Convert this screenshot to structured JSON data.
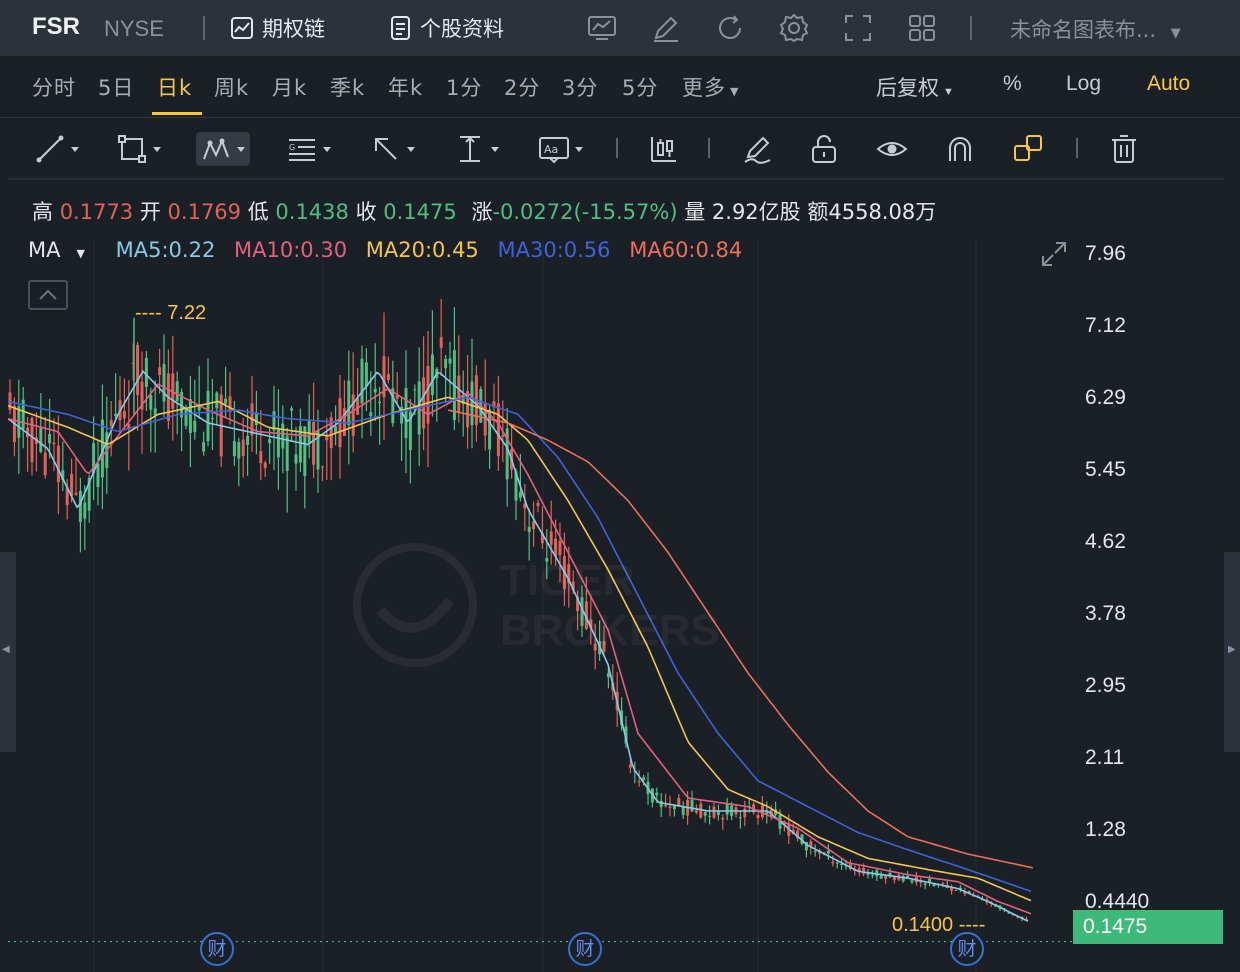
{
  "header": {
    "ticker": "FSR",
    "exchange": "NYSE",
    "options_chain_label": "期权链",
    "stock_profile_label": "个股资料",
    "chart_name": "未命名图表布..."
  },
  "periods": {
    "items": [
      "分时",
      "5日",
      "日k",
      "周k",
      "月k",
      "季k",
      "年k",
      "1分",
      "2分",
      "3分",
      "5分",
      "更多"
    ],
    "active": "日k"
  },
  "options": {
    "adjust_label": "后复权",
    "percent_label": "%",
    "log_label": "Log",
    "auto_label": "Auto"
  },
  "quote": {
    "high_label": "高",
    "high": "0.1773",
    "open_label": "开",
    "open": "0.1769",
    "low_label": "低",
    "low": "0.1438",
    "close_label": "收",
    "close": "0.1475",
    "change_label": "涨",
    "change": "-0.0272(-15.57%)",
    "volume_label": "量",
    "volume": "2.92亿股",
    "amount_label": "额",
    "amount": "4558.08万"
  },
  "ma": {
    "label": "MA",
    "ma5": "MA5:0.22",
    "ma10": "MA10:0.30",
    "ma20": "MA20:0.45",
    "ma30": "MA30:0.56",
    "ma60": "MA60:0.84"
  },
  "colors": {
    "up": "#e0635a",
    "down": "#4fbf83",
    "ma5": "#86cbe8",
    "ma10": "#e2617e",
    "ma20": "#f1c550",
    "ma30": "#3f63d8",
    "ma60": "#ea6f5c",
    "accent": "#f5c842"
  },
  "annotations": {
    "high_marker": "---- 7.22",
    "low_marker": "0.1400 ----",
    "earnings_badge": "财",
    "last_price": "0.1475"
  },
  "watermark": {
    "line1": "TIGER",
    "line2": "BROKERS"
  },
  "chart_data": {
    "type": "candlestick",
    "y_ticks": [
      "7.96",
      "7.12",
      "6.29",
      "5.45",
      "4.62",
      "3.78",
      "2.95",
      "2.11",
      "1.28",
      "0.4440"
    ],
    "ylim": [
      0.1,
      7.96
    ],
    "period_high": 7.22,
    "period_low": 0.14,
    "last_close": 0.1475,
    "ma_series": [
      {
        "name": "MA5",
        "anchors": [
          [
            0,
            6.05
          ],
          [
            40,
            5.7
          ],
          [
            70,
            5.0
          ],
          [
            110,
            6.1
          ],
          [
            135,
            6.6
          ],
          [
            160,
            6.3
          ],
          [
            200,
            6.0
          ],
          [
            240,
            5.9
          ],
          [
            300,
            5.75
          ],
          [
            330,
            6.0
          ],
          [
            370,
            6.6
          ],
          [
            400,
            6.0
          ],
          [
            430,
            6.6
          ],
          [
            470,
            6.2
          ],
          [
            500,
            5.7
          ],
          [
            520,
            5.0
          ],
          [
            560,
            4.2
          ],
          [
            600,
            3.2
          ],
          [
            625,
            2.0
          ],
          [
            650,
            1.6
          ],
          [
            700,
            1.5
          ],
          [
            760,
            1.5
          ],
          [
            800,
            1.1
          ],
          [
            850,
            0.8
          ],
          [
            900,
            0.72
          ],
          [
            950,
            0.6
          ],
          [
            980,
            0.45
          ],
          [
            1020,
            0.22
          ]
        ]
      },
      {
        "name": "MA10",
        "anchors": [
          [
            0,
            6.05
          ],
          [
            50,
            5.9
          ],
          [
            80,
            5.4
          ],
          [
            120,
            6.0
          ],
          [
            150,
            6.45
          ],
          [
            200,
            6.15
          ],
          [
            250,
            5.9
          ],
          [
            300,
            5.85
          ],
          [
            340,
            6.1
          ],
          [
            380,
            6.4
          ],
          [
            420,
            6.1
          ],
          [
            460,
            6.35
          ],
          [
            490,
            6.0
          ],
          [
            520,
            5.4
          ],
          [
            560,
            4.5
          ],
          [
            600,
            3.6
          ],
          [
            630,
            2.4
          ],
          [
            680,
            1.65
          ],
          [
            740,
            1.55
          ],
          [
            790,
            1.3
          ],
          [
            840,
            0.9
          ],
          [
            900,
            0.76
          ],
          [
            950,
            0.68
          ],
          [
            990,
            0.45
          ],
          [
            1025,
            0.3
          ]
        ]
      },
      {
        "name": "MA20",
        "anchors": [
          [
            0,
            6.2
          ],
          [
            60,
            5.95
          ],
          [
            100,
            5.75
          ],
          [
            150,
            6.1
          ],
          [
            210,
            6.25
          ],
          [
            260,
            5.95
          ],
          [
            320,
            5.85
          ],
          [
            380,
            6.1
          ],
          [
            440,
            6.3
          ],
          [
            490,
            6.1
          ],
          [
            520,
            5.8
          ],
          [
            560,
            5.1
          ],
          [
            600,
            4.3
          ],
          [
            640,
            3.4
          ],
          [
            680,
            2.3
          ],
          [
            720,
            1.75
          ],
          [
            760,
            1.55
          ],
          [
            810,
            1.2
          ],
          [
            860,
            0.95
          ],
          [
            920,
            0.82
          ],
          [
            970,
            0.72
          ],
          [
            1025,
            0.45
          ]
        ]
      },
      {
        "name": "MA30",
        "anchors": [
          [
            0,
            6.25
          ],
          [
            60,
            6.1
          ],
          [
            110,
            5.9
          ],
          [
            170,
            6.1
          ],
          [
            230,
            6.15
          ],
          [
            280,
            6.05
          ],
          [
            340,
            6.0
          ],
          [
            400,
            6.15
          ],
          [
            460,
            6.3
          ],
          [
            510,
            6.1
          ],
          [
            550,
            5.6
          ],
          [
            590,
            4.9
          ],
          [
            630,
            4.0
          ],
          [
            670,
            3.1
          ],
          [
            710,
            2.4
          ],
          [
            750,
            1.85
          ],
          [
            800,
            1.55
          ],
          [
            850,
            1.25
          ],
          [
            900,
            1.05
          ],
          [
            960,
            0.82
          ],
          [
            1025,
            0.56
          ]
        ]
      },
      {
        "name": "MA60",
        "anchors": [
          [
            440,
            6.15
          ],
          [
            500,
            6.0
          ],
          [
            540,
            5.8
          ],
          [
            580,
            5.55
          ],
          [
            620,
            5.1
          ],
          [
            660,
            4.5
          ],
          [
            700,
            3.8
          ],
          [
            740,
            3.1
          ],
          [
            780,
            2.5
          ],
          [
            820,
            1.95
          ],
          [
            860,
            1.5
          ],
          [
            900,
            1.2
          ],
          [
            960,
            1.0
          ],
          [
            1025,
            0.84
          ]
        ]
      }
    ]
  }
}
